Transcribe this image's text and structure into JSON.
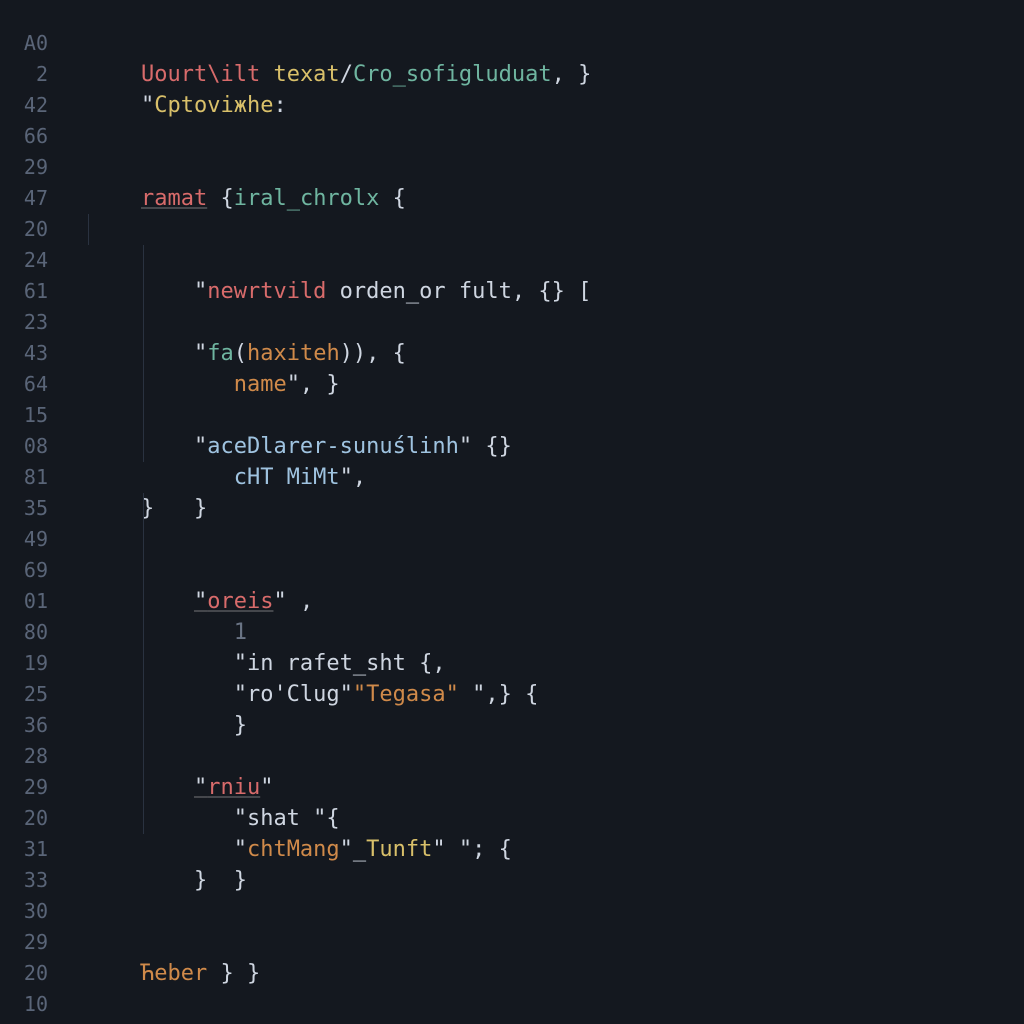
{
  "gutter": [
    "A0",
    "2",
    "42",
    "66",
    "29",
    "47",
    "20",
    "24",
    "61",
    "23",
    "43",
    "64",
    "15",
    "08",
    "81",
    "35",
    "49",
    "69",
    "01",
    "80",
    "19",
    "25",
    "36",
    "28",
    "29",
    "20",
    "31",
    "33",
    "30",
    "29",
    "20",
    "10"
  ],
  "lines": {
    "l0": {
      "t0": "Uourt",
      "t1": "\\ilt",
      "t2": " texat",
      "t3": "/",
      "t4": "Cro_sofigluduat",
      "t5": ", }"
    },
    "l1": {
      "t0": "\"",
      "t1": "Cptoviжhe",
      "t2": ":"
    },
    "l2": {
      "t0": "ramat",
      "t1": " {",
      "t2": "iral_chrolx",
      "t3": " {"
    },
    "l3": {
      "t0": "\"",
      "t1": "newrtvild",
      "t2": " orden_or fult",
      "t3": ", {} ["
    },
    "l4": {
      "t0": "\"",
      "t1": "fa",
      "t2": "(",
      "t3": "haxiteh",
      "t4": ")), {"
    },
    "l5": {
      "t0": "name",
      "t1": "\", }"
    },
    "l6": {
      "t0": "\"",
      "t1": "aceDlarer-sunuślinh",
      "t2": "\" {}"
    },
    "l7": {
      "t0": "cHT MiMt",
      "t1": "\","
    },
    "l8": {
      "t0": "}"
    },
    "l9": {
      "t0": "}"
    },
    "l10": {
      "t0": "\"",
      "t1": "oreis",
      "t2": "\" ,"
    },
    "l11": {
      "t0": "1"
    },
    "l12": {
      "t0": "\"in rafet_sht {,"
    },
    "l13": {
      "t0": "\"ro'Clug\"",
      "t1": "\"Tegasa\"",
      "t2": " \",} {"
    },
    "l14": {
      "t0": "}"
    },
    "l15": {
      "t0": "\"",
      "t1": "rniu",
      "t2": "\""
    },
    "l16": {
      "t0": "\"shat \"{"
    },
    "l17": {
      "t0": "\"",
      "t1": "chtMang",
      "t2": "\"_",
      "t3": "Tunft",
      "t4": "\" \"; {"
    },
    "l18": {
      "t0": "}"
    },
    "l19": {
      "t0": "}"
    },
    "l20": {
      "t0": "Ћeber",
      "t1": " } }"
    }
  }
}
